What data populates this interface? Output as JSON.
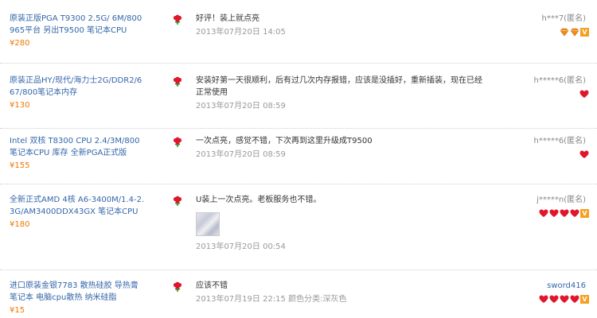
{
  "reviews": [
    {
      "product": "原装正版PGA T9300 2.5G/ 6M/800 965平台 另出T9500 笔记本CPU",
      "price": "¥280",
      "comment": "好评！装上就点亮",
      "date": "2013年07月20日 14:05",
      "user": "h***7(匿名)",
      "badges": [
        "diamond-icon",
        "diamond-icon",
        "vip-icon"
      ]
    },
    {
      "product": "原装正品HY/现代/海力士2G/DDR2/667/800笔记本内存",
      "price": "¥130",
      "comment": "安装好第一天很顺利，后有过几次内存报错，应该是没插好，重新插装，现在已经正常使用",
      "date": "2013年07月20日 08:59",
      "user": "h*****6(匿名)",
      "badges": [
        "heart-icon"
      ]
    },
    {
      "product": "Intel 双核 T8300 CPU 2.4/3M/800 笔记本CPU 库存 全新PGA正式版",
      "price": "¥155",
      "comment": "一次点亮，感觉不错，下次再到这里升级成T9500",
      "date": "2013年07月20日 08:59",
      "user": "h*****6(匿名)",
      "badges": [
        "heart-icon"
      ]
    },
    {
      "product": "全新正式AMD 4核 A6-3400M/1.4-2.3G/AM3400DDX43GX 笔记本CPU",
      "price": "¥180",
      "comment": "U装上一次点亮。老板服务也不错。",
      "date": "2013年07月20日 00:54",
      "user": "j*****n(匿名)",
      "badges": [
        "heart-icon",
        "heart-icon",
        "heart-icon",
        "heart-icon",
        "vip-icon"
      ],
      "has_photo": true
    },
    {
      "product": "进口原装金银7783 散热硅胶 导热膏 笔记本 电脑cpu散热 纳米硅脂",
      "price": "¥15",
      "comment": "应该不错",
      "date": "2013年07月19日 22:15 颜色分类:深灰色",
      "user": "sword416",
      "badges": [
        "heart-icon",
        "heart-icon",
        "heart-icon",
        "heart-icon",
        "vip-icon"
      ]
    }
  ],
  "colors": {
    "link": "#3366aa",
    "price": "#ee7700",
    "muted": "#999999",
    "heart": "#e0162b",
    "diamond": "#f08a1a",
    "vip": "#f4a021"
  }
}
